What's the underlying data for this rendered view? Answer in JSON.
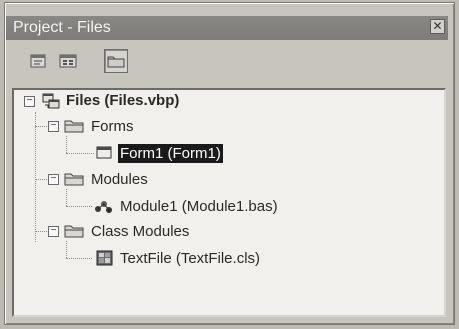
{
  "window": {
    "title": "Project - Files",
    "close_glyph": "✕"
  },
  "toolbar": {
    "buttons": [
      {
        "name": "view-code-button",
        "icon": "view-code-icon"
      },
      {
        "name": "view-object-button",
        "icon": "view-object-icon"
      },
      {
        "name": "toggle-folders-button",
        "icon": "folder-icon",
        "pressed": true
      }
    ]
  },
  "tree": {
    "project": {
      "label": "Files (Files.vbp)",
      "expander": "−"
    },
    "forms": {
      "label": "Forms",
      "expander": "−"
    },
    "form1": {
      "label": "Form1 (Form1)",
      "selected": true
    },
    "modules": {
      "label": "Modules",
      "expander": "−"
    },
    "module1": {
      "label": "Module1 (Module1.bas)"
    },
    "class_modules": {
      "label": "Class Modules",
      "expander": "−"
    },
    "textfile": {
      "label": "TextFile (TextFile.cls)"
    }
  }
}
